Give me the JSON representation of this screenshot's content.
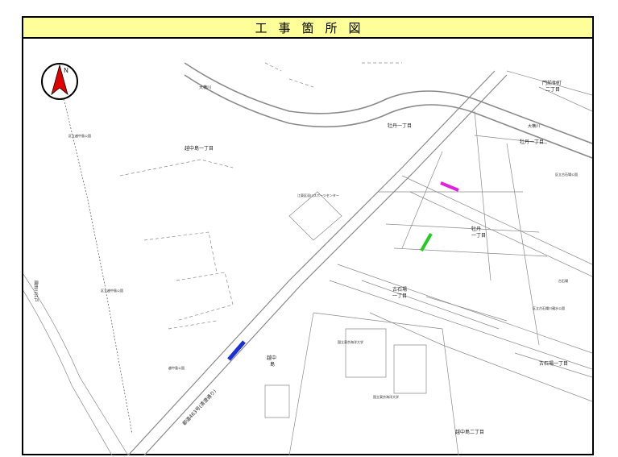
{
  "title": "工事箇所図",
  "north_label": "N",
  "labels": {
    "koshinakajima1": "越中島一丁目",
    "koshinakajima2": "越中島二丁目",
    "botan1_top": "牡丹一丁目",
    "botan1_right": "牡丹一丁目",
    "botan1_center_a": "牡丹",
    "botan1_center_b": "一丁目",
    "furuishiba1_center_a": "古石場",
    "furuishiba1_center_b": "一丁目",
    "furuishiba1_right": "古石場一丁目",
    "monzen_a": "門前仲町",
    "monzen_b": "二丁目",
    "oyokogawa_left": "大横川",
    "oyokogawa_right": "大横川",
    "sports_center": "江東区深川スポーツセンター",
    "univ_1": "国立東京海洋大学",
    "univ_2": "国立東京海洋大学",
    "park_kg": "越中島公園",
    "station_a": "越中",
    "station_b": "島",
    "route": "都道463号(清澄通り)",
    "ward": "隅田川/江戸",
    "small_park_1": "区立越中島公園",
    "small_park_2": "区立越中島公園",
    "small_park_3": "区立古石場公園",
    "small_park_4": "古石場",
    "small_park_5": "区立古石場川親水公園"
  },
  "markers": [
    {
      "name": "work-site-magenta",
      "color": "#e020e0"
    },
    {
      "name": "work-site-green",
      "color": "#22cc22"
    },
    {
      "name": "work-site-blue",
      "color": "#1b2fd6"
    }
  ]
}
